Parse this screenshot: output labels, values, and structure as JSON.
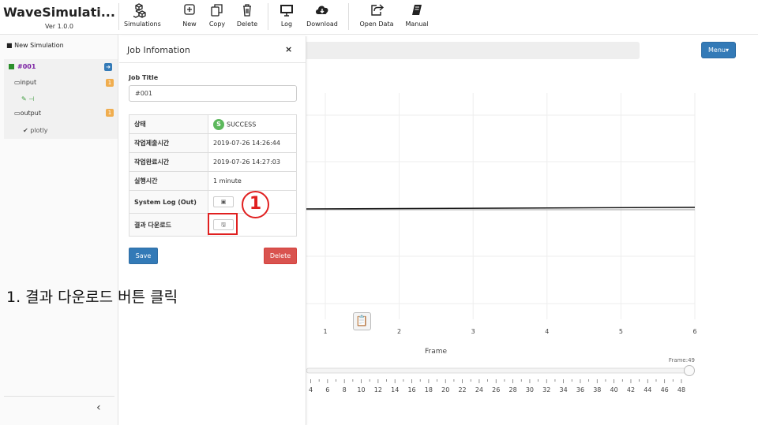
{
  "app": {
    "title": "WaveSimulati...",
    "version": "Ver 1.0.0"
  },
  "toolbar": {
    "simulations": "Simulations",
    "new": "New",
    "copy": "Copy",
    "delete": "Delete",
    "log": "Log",
    "download": "Download",
    "open_data": "Open Data",
    "manual": "Manual"
  },
  "sidebar": {
    "new_simulation": "New Simulation",
    "job": "#001",
    "input": "input",
    "input_badge": "1",
    "output": "output",
    "output_badge": "1",
    "plotly": "plotly",
    "collapse": "‹"
  },
  "main": {
    "menu_label": "Menu▾"
  },
  "panel": {
    "title": "Job Infomation",
    "close": "×",
    "job_title_label": "Job Title",
    "job_title_value": "#001",
    "rows": [
      {
        "key": "상태",
        "value": "SUCCESS"
      },
      {
        "key": "작업제출시간",
        "value": "2019-07-26 14:26:44"
      },
      {
        "key": "작업완료시간",
        "value": "2019-07-26 14:27:03"
      },
      {
        "key": "실행시간",
        "value": "1 minute"
      },
      {
        "key": "System Log (Out)",
        "value": ""
      },
      {
        "key": "결과 다운로드",
        "value": ""
      }
    ],
    "save": "Save",
    "delete": "Delete"
  },
  "annotation": {
    "marker": "1",
    "caption": "1. 결과 다운로드 버튼 클릭"
  },
  "chart_data": {
    "type": "line",
    "x_ticks": [
      "1",
      "2",
      "3",
      "4",
      "5",
      "6"
    ],
    "xlabel": "Frame",
    "frame_label": "Frame:49",
    "slider_ticks": [
      "4",
      "6",
      "8",
      "10",
      "12",
      "14",
      "16",
      "18",
      "20",
      "22",
      "24",
      "26",
      "28",
      "30",
      "32",
      "34",
      "36",
      "38",
      "40",
      "42",
      "44",
      "46",
      "48"
    ],
    "slider_value": 49
  }
}
